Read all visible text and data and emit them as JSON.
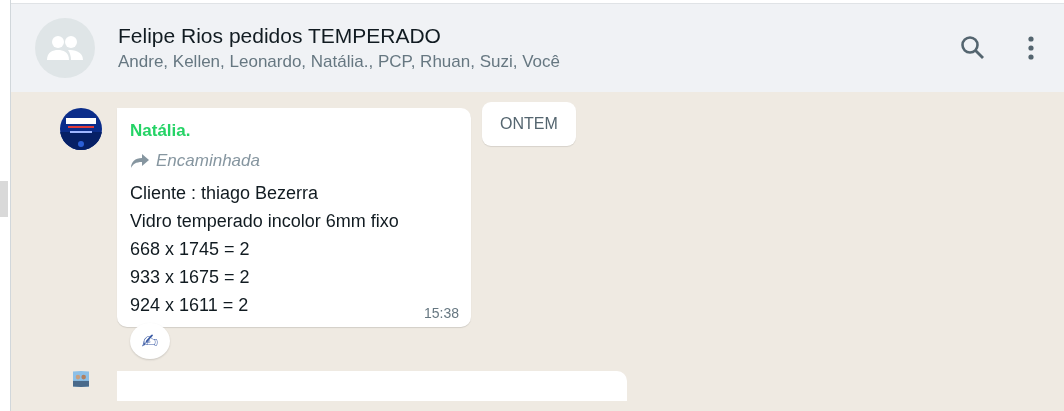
{
  "header": {
    "title": "Felipe Rios pedidos TEMPERADO",
    "participants": "Andre, Kellen, Leonardo, Natália., PCP, Rhuan, Suzi, Você"
  },
  "messages": [
    {
      "kind": "text",
      "sender": "Natália.",
      "color": "#25d366",
      "forwarded": true,
      "forwarded_label": "Encaminhada",
      "lines": [
        "Cliente : thiago Bezerra",
        "Vidro temperado incolor 6mm fixo",
        "668 x 1745 = 2",
        "933 x 1675 = 2",
        "924 x 1611 = 2"
      ],
      "time": "15:38",
      "reaction": "✍"
    },
    {
      "kind": "partial"
    }
  ],
  "date_badge": "ONTEM"
}
